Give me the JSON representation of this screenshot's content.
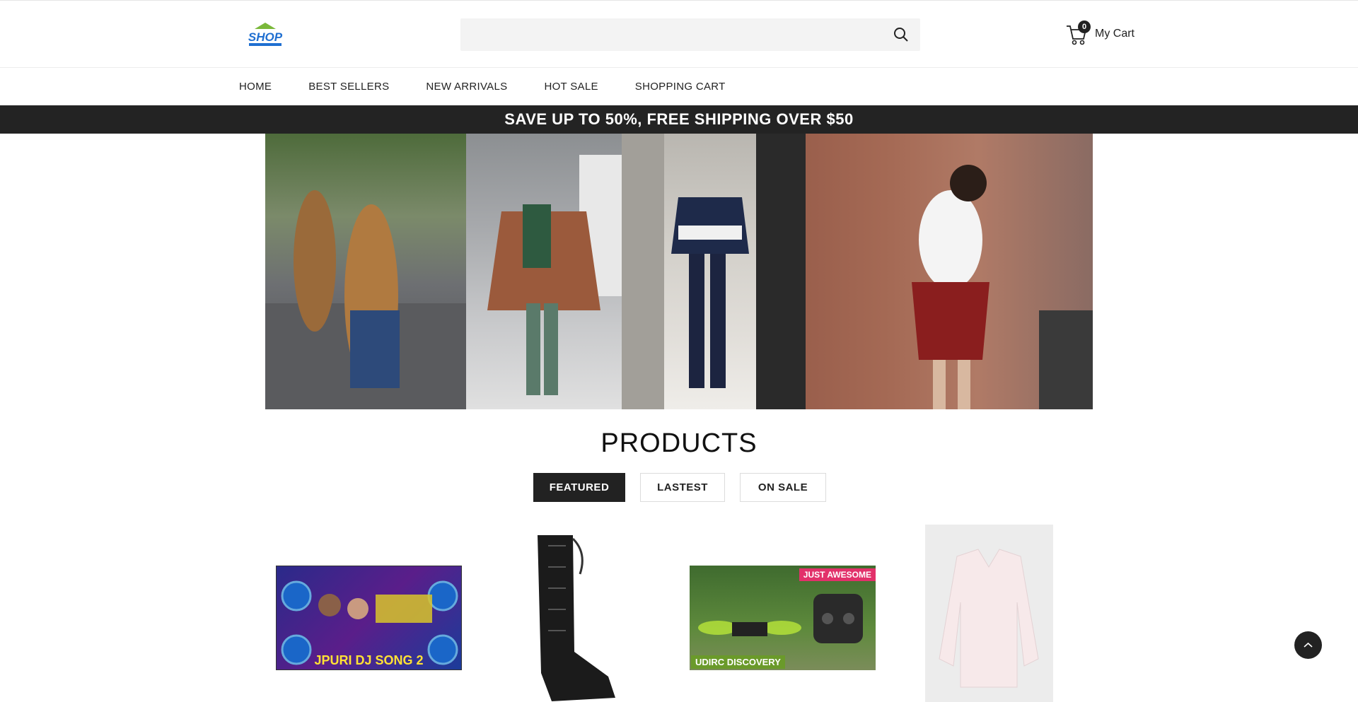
{
  "header": {
    "logo_alt": "SHOP",
    "search": {
      "placeholder": "",
      "icon": "search-icon"
    },
    "cart": {
      "count": "0",
      "label": "My Cart",
      "icon": "cart-icon"
    }
  },
  "nav": {
    "items": [
      {
        "label": "HOME"
      },
      {
        "label": "BEST SELLERS"
      },
      {
        "label": "NEW ARRIVALS"
      },
      {
        "label": "HOT SALE"
      },
      {
        "label": "SHOPPING CART"
      }
    ]
  },
  "promo": {
    "text": "SAVE UP TO 50%, FREE SHIPPING OVER $50"
  },
  "products": {
    "title": "PRODUCTS",
    "tabs": [
      {
        "label": "FEATURED",
        "active": true
      },
      {
        "label": "LASTEST",
        "active": false
      },
      {
        "label": "ON SALE",
        "active": false
      }
    ],
    "items": [
      {
        "caption": "JPURI DJ SONG 2"
      },
      {
        "caption": ""
      },
      {
        "tag": "JUST AWESOME",
        "caption": "UDIRC DISCOVERY"
      },
      {
        "caption": ""
      }
    ]
  },
  "colors": {
    "promo_bg": "#232323",
    "tab_active_bg": "#222222",
    "logo_green": "#7ab83a",
    "logo_blue": "#1f6fd1"
  }
}
